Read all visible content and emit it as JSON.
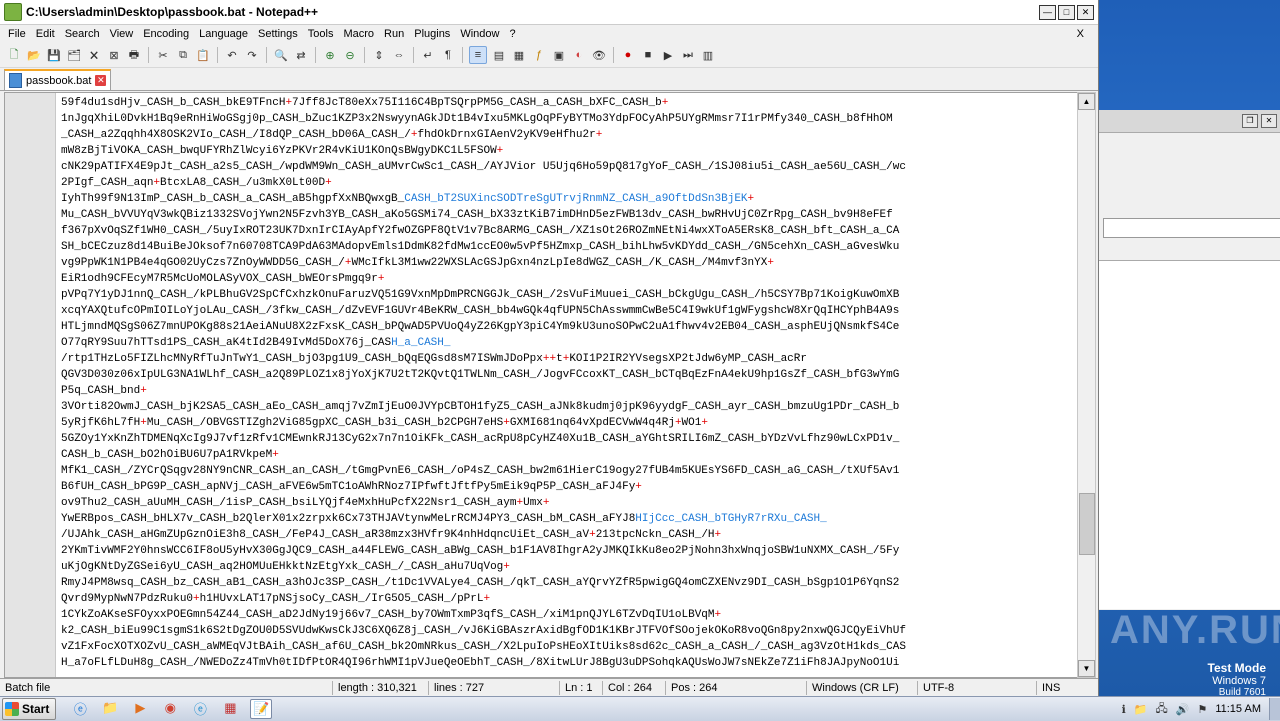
{
  "window": {
    "title": "C:\\Users\\admin\\Desktop\\passbook.bat - Notepad++"
  },
  "menu": [
    "File",
    "Edit",
    "Search",
    "View",
    "Encoding",
    "Language",
    "Settings",
    "Tools",
    "Macro",
    "Run",
    "Plugins",
    "Window",
    "?"
  ],
  "menu_close": "X",
  "tab": {
    "label": "passbook.bat"
  },
  "lines": [
    {
      "text": "59f4du1sdHjv_CASH_b_CASH_bkE9TFncH",
      "tail": "7Jff8JcT80eXx75I116C4BpTSQrpPM5G_CASH_a_CASH_bXFC_CASH_b",
      "end": "+"
    },
    {
      "text": "1nJgqXhiL0DvkH1Bq9eRnHiWoGSgj0p_CASH_bZuc1KZP3x2NswyynAGkJDt1B4vIxu5MKLgOqPFyBYTMo3YdpFOCyAhP5UYgRMmsr7I1rPMfy340_CASH_b8fHhOM",
      "tail": "",
      "end": ""
    },
    {
      "text": "_CASH_a2Zqqhh4X8OSK2VIo_CASH_/I8dQP_CASH_bD06A_CASH_/",
      "tail": "fhdOkDrnxGIAenV2yKV9eHfhu2r",
      "end": "+"
    },
    {
      "text": "mW8zBjTiVOKA_CASH_bwqUFYRhZlWcyi6YzPKVr2R4vKiU1KOnQsBWgyDKC1L5FSOW",
      "tail": "",
      "end": "+"
    },
    {
      "text": "cNK29pATIFX4E9pJt_CASH_a2s5_CASH_/wpdWM9Wn_CASH_aUMvrCwSc1_CASH_/AYJVior U5Ujq6Ho59pQ817gYoF_CASH_/1SJ08iu5i_CASH_ae56U_CASH_/wc",
      "tail": "",
      "end": ""
    },
    {
      "text": "2PIgf_CASH_aqn",
      "tail": "BtcxLA8_CASH_/u3mkX0Lt00D",
      "end": "+"
    },
    {
      "text": "IyhTh99f9N13ImP_CASH_b_CASH_a_CASH_aB5hgpfXxNBQwxgB_",
      "blue": "CASH_bT2SUXincSODTreSgUTrvjRnmNZ_CASH_a9OftDdSn3BjEK",
      "end": "+"
    },
    {
      "text": "Mu_CASH_bVVUYqV3wkQBiz1332SVojYwn2N5Fzvh3YB_CASH_aKo5GSMi74_CASH_bX33ztKiB7imDHnD5ezFWB13dv_CASH_bwRHvUjC0ZrRpg_CASH_bv9H8eFEf",
      "tail": "",
      "end": ""
    },
    {
      "text": "f367pXvOqSZf1WH0_CASH_/5uyIxROT23UK7DxnIrCIAyApfY2fwOZGPF8QtV1v7Bc8ARMG_CASH_/XZ1sOt26ROZmNEtNi4wxXToA5ERsK8_CASH_bft_CASH_a_CA",
      "tail": "",
      "end": ""
    },
    {
      "text": "SH_bCECzuz8d14BuiBeJOksof7n60708TCA9PdA63MAdopvEmls1DdmK82fdMw1ccEO0w5vPf5HZmxp_CASH_bihLhw5vKDYdd_CASH_/GN5cehXn_CASH_aGvesWku",
      "tail": "",
      "end": ""
    },
    {
      "text": "vg9PpWK1N1PB4e4qGO02UyCzs7ZnOyWWDD5G_CASH_/",
      "tail": "WMcIfkL3M1ww22WXSLAcGSJpGxn4nzLpIe8dWGZ_CASH_/K_CASH_/M4mvf3nYX",
      "end": "+"
    },
    {
      "text": "EiR1odh9CFEcyM7R5McUoMOLASyVOX_CASH_bWEOrsPmgq9r",
      "tail": "",
      "end": "+"
    },
    {
      "text": "pVPq7Y1yDJ1nnQ_CASH_/kPLBhuGV2SpCfCxhzkOnuFaruzVQ51G9VxnMpDmPRCNGGJk_CASH_/2sVuFiMuuei_CASH_bCkgUgu_CASH_/h5CSY7Bp71KoigKuwOmXB",
      "tail": "",
      "end": ""
    },
    {
      "text": "xcqYAXQtufcOPmIOILoYjoLAu_CASH_/3fkw_CASH_/dZvEVF1GUVr4BeKRW_CASH_bb4wGQk4qfUPN5ChAsswmmCwBe5C4I9wkUf1gWFygshcW8XrQqIHCYphB4A9s",
      "tail": "",
      "end": ""
    },
    {
      "text": "HTLjmndMQSgS06Z7mnUPOKg88s21AeiANuU8X2zFxsK_CASH_bPQwAD5PVUoQ4yZ26KgpY3piC4Ym9kU3unoSOPwC2uA1fhwv4v2EB04_CASH_asphEUjQNsmkfS4Ce",
      "tail": "",
      "end": ""
    },
    {
      "text": "O77qRY9Suu7hTTsd1PS_CASH_aK4tId2B49IvMd5DoX76j_CAS",
      "blue": "H_a_CASH_",
      "end": ""
    },
    {
      "text": "/rtp1THzLo5FIZLhcMNyRfTuJnTwY1_CASH_bjO3pg1U9_CASH_bQqEQGsd8sM7ISWmJDoPpx",
      "tail": "t",
      "end": "+",
      "pre": "+",
      "post": "KOI1P2IR2YVsegsXP2tJdw6yMP_CASH_acRr"
    },
    {
      "text": "QGV3D030z06xIpULG3NA1WLhf_CASH_a2Q89PLOZ1x8jYoXjK7U2tT2KQvtQ1TWLNm_CASH_/JogvFCcoxKT_CASH_bCTqBqEzFnA4ekU9hp1GsZf_CASH_bfG3wYmG",
      "tail": "",
      "end": ""
    },
    {
      "text": "P5q_CASH_bnd",
      "tail": "",
      "end": "+"
    },
    {
      "text": "3VOrti82OwmJ_CASH_bjK2SA5_CASH_aEo_CASH_amqj7vZmIjEuO0JVYpCBTOH1fyZ5_CASH_aJNk8kudmj0jpK96yydgF_CASH_ayr_CASH_bmzuUg1PDr_CASH_b",
      "tail": "",
      "end": ""
    },
    {
      "text": "5yRjfK6hL7fH",
      "tail": "Mu_CASH_/OBVGSTIZgh2ViG85gpXC_CASH_b3i_CASH_b2CPGH7eHS",
      "end": "+",
      "post": "GXMI681nq64vXpdECVwW4q4Rj",
      "post2": "WO1"
    },
    {
      "text": "5GZOy1YxKnZhTDMENqXcIg9J7vf1zRfv1CMEwnkRJ13CyG2x7n7n1OiKFk_CASH_acRpU8pCyHZ40Xu1B_CASH_aYGhtSRILI6mZ_CASH_bYDzVvLfhz90wLCxPD1v_",
      "tail": "",
      "end": ""
    },
    {
      "text": "CASH_b_CASH_bO2hOiBU6U7pA1RVkpeM",
      "tail": "",
      "end": "+"
    },
    {
      "text": "MfK1_CASH_/ZYCrQSqgv28NY9nCNR_CASH_an_CASH_/tGmgPvnE6_CASH_/oP4sZ_CASH_bw2m61HierC19ogy27fUB4m5KUEsYS6FD_CASH_aG_CASH_/tXUf5Av1",
      "tail": "",
      "end": ""
    },
    {
      "text": "B6fUH_CASH_bPG9P_CASH_apNVj_CASH_aFVE6w5mTC1oAWhRNoz7IPfwftJftfPy5mEik9qP5P_CASH_aFJ4Fy",
      "tail": "",
      "end": "+"
    },
    {
      "text": "ov9Thu2_CASH_aUuMH_CASH_/1isP_CASH_bsiLYQjf4eMxhHuPcfX22Nsr1_CASH_aym",
      "tail": "Umx",
      "end": "+"
    },
    {
      "text": "YwERBpos_CASH_bHLX7v_CASH_b2QlerX01x2zrpxk6Cx73THJAVtynwMeLrRCMJ4PY3_CASH_bM_CASH_aFYJ8",
      "blue": "HIjCcc_CASH_bTGHyR7rRXu_CASH_",
      "end": ""
    },
    {
      "text": "/UJAhk_CASH_aHGmZUpGznOiE3h8_CASH_/FeP4J_CASH_aR38mzx3HVfr9K4nhHdqncUiEt_CASH_aV",
      "tail": "213tpcNckn_CASH_/H",
      "end": "+"
    },
    {
      "text": "2YKmTivWMF2Y0hnsWCC6IF8oU5yHvX30GgJQC9_CASH_a44FLEWG_CASH_aBWg_CASH_b1F1AV8IhgrA2yJMKQIkKu8eo2PjNohn3hxWnqjoSBW1uNXMX_CASH_/5Fy",
      "tail": "",
      "end": ""
    },
    {
      "text": "uKjOgKNtDyZGSei6yU_CASH_aq2HOMUuEHkktNzEtgYxk_CASH_/_CASH_aHu7UqVog",
      "tail": "",
      "end": "+"
    },
    {
      "text": "RmyJ4PM8wsq_CASH_bz_CASH_aB1_CASH_a3hOJc3SP_CASH_/t1Dc1VVALye4_CASH_/qkT_CASH_aYQrvYZfR5pwigGQ4omCZXENvz9DI_CASH_bSgp1O1P6YqnS2",
      "tail": "",
      "end": ""
    },
    {
      "text": "Qvrd9MypNwN7PdzRuku0",
      "tail": "h1HUvxLAT17pNSjsoCy_CASH_/IrG5O5_CASH_/pPrL",
      "end": "+"
    },
    {
      "text": "1CYkZoAKseSFOyxxPOEGmn54Z44_CASH_aD2JdNy19j66v7_CASH_by7OWmTxmP3qfS_CASH_/xiM1pnQJYL6TZvDqIU1oLBVqM",
      "tail": "",
      "end": "+"
    },
    {
      "text": "k2_CASH_biEu99C1sgmS1k6S2tDgZOU0D5SVUdwKwsCkJ3C6XQ6Z8j_CASH_/vJ6KiGBAszrAxidBgfOD1K1KBrJTFVOfSOojekOKoR8voQGn8py2nxwQGJCQyEiVhUf",
      "tail": "",
      "end": ""
    },
    {
      "text": "vZ1FxFocXOTXOZvU_CASH_aWMEqVJtBAih_CASH_af6U_CASH_bk2OmNRkus_CASH_/X2LpuIoPsHEoXItUiks8sd62c_CASH_a_CASH_/_CASH_ag3VzOtH1kds_CAS",
      "tail": "",
      "end": ""
    },
    {
      "text": "H_a7oFLfLDuH8g_CASH_/NWEDoZz4TmVh0tIDfPtOR4QI96rhWMI1pVJueQeOEbhT_CASH_/8XitwLUrJ8BgU3uDPSohqkAQUsWoJW7sNEkZe7Z1iFh8JAJpyNoO1Ui",
      "tail": "",
      "end": ""
    }
  ],
  "status": {
    "filetype": "Batch file",
    "length": "length : 310,321",
    "lines": "lines : 727",
    "ln": "Ln : 1",
    "col": "Col : 264",
    "pos": "Pos : 264",
    "eol": "Windows (CR LF)",
    "encoding": "UTF-8",
    "ins": "INS"
  },
  "os_watermark": {
    "line1": "Test Mode",
    "line2": "Windows 7",
    "line3": "Build 7601"
  },
  "anyrun": "ANY.RUN",
  "taskbar": {
    "start_label": "Start",
    "clock": "11:15 AM"
  },
  "colors": {
    "accent_tab": "#f5a623",
    "plus_red": "#e00000",
    "link_blue": "#1e7ad8"
  }
}
